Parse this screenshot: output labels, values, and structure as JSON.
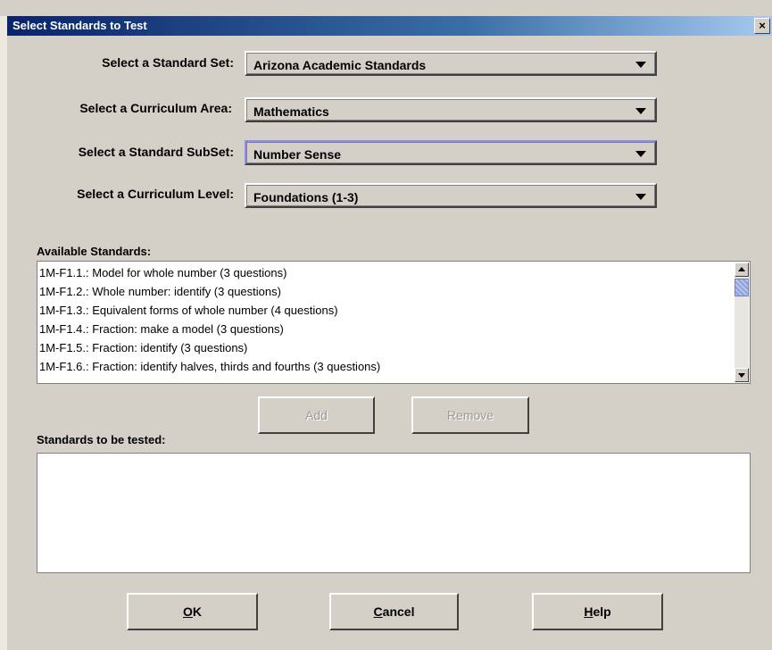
{
  "window": {
    "title": "Select Standards to Test",
    "close_glyph": "×"
  },
  "selectors": {
    "standard_set": {
      "label": "Select a Standard Set:",
      "value": "Arizona Academic Standards"
    },
    "curriculum_area": {
      "label": "Select a Curriculum Area:",
      "value": "Mathematics"
    },
    "standard_subset": {
      "label": "Select a Standard SubSet:",
      "value": "Number Sense"
    },
    "curriculum_level": {
      "label": "Select a Curriculum Level:",
      "value": "Foundations (1-3)"
    }
  },
  "available": {
    "label": "Available Standards:",
    "items": [
      "1M-F1.1.: Model for whole number (3 questions)",
      "1M-F1.2.: Whole number: identify (3 questions)",
      "1M-F1.3.: Equivalent forms of whole number (4 questions)",
      "1M-F1.4.: Fraction: make a model (3 questions)",
      "1M-F1.5.: Fraction: identify (3 questions)",
      "1M-F1.6.: Fraction: identify halves, thirds and fourths (3 questions)"
    ]
  },
  "actions": {
    "add_label": "Add",
    "remove_label": "Remove"
  },
  "tested": {
    "label": "Standards to be tested:"
  },
  "footer": {
    "ok_mnemonic": "O",
    "ok_rest": "K",
    "cancel_mnemonic": "C",
    "cancel_rest": "ancel",
    "help_mnemonic": "H",
    "help_rest": "elp"
  }
}
